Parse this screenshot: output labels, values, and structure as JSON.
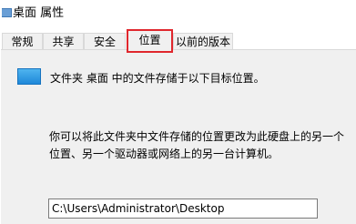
{
  "window": {
    "title": "桌面 属性"
  },
  "tabs": [
    {
      "label": "常规"
    },
    {
      "label": "共享"
    },
    {
      "label": "安全"
    },
    {
      "label": "位置",
      "active": true
    },
    {
      "label": "以前的版本"
    }
  ],
  "location": {
    "description": "文件夹 桌面 中的文件存储于以下目标位置。",
    "info_line1": "你可以将此文件夹中文件存储的位置更改为此硬盘上的另一个",
    "info_line2": "位置、另一个驱动器或网络上的另一台计算机。",
    "path_value": "C:\\Users\\Administrator\\Desktop"
  },
  "colors": {
    "active_tab_highlight": "#e0272d",
    "folder_icon": "#1e88d9"
  }
}
